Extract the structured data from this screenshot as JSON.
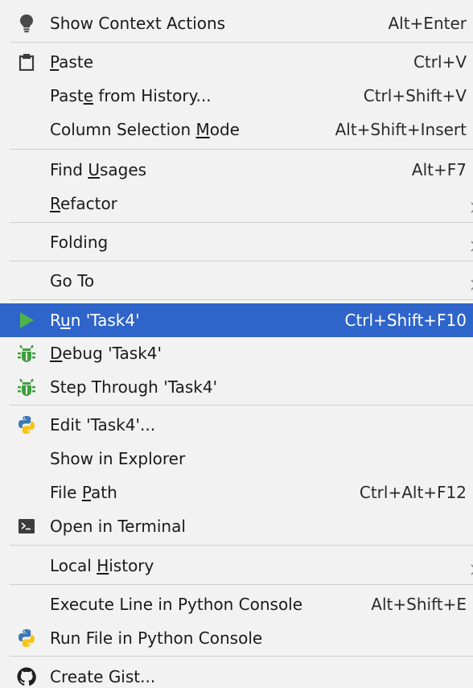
{
  "menu": {
    "items": [
      {
        "label": "Show Context Actions",
        "mnemonic": null,
        "shortcut": "Alt+Enter",
        "icon": "lightbulb-icon"
      },
      {
        "label": "Paste",
        "mnemonic": 0,
        "shortcut": "Ctrl+V",
        "icon": "clipboard-icon"
      },
      {
        "label": "Paste from History...",
        "mnemonic": 4,
        "shortcut": "Ctrl+Shift+V",
        "icon": null
      },
      {
        "label": "Column Selection Mode",
        "mnemonic": 17,
        "shortcut": "Alt+Shift+Insert",
        "icon": null
      },
      {
        "label": "Find Usages",
        "mnemonic": 5,
        "shortcut": "Alt+F7",
        "icon": null
      },
      {
        "label": "Refactor",
        "mnemonic": 0,
        "shortcut": "",
        "icon": null,
        "submenu": true
      },
      {
        "label": "Folding",
        "mnemonic": null,
        "shortcut": "",
        "icon": null,
        "submenu": true
      },
      {
        "label": "Go To",
        "mnemonic": null,
        "shortcut": "",
        "icon": null,
        "submenu": true
      },
      {
        "label": "Run 'Task4'",
        "mnemonic": 1,
        "shortcut": "Ctrl+Shift+F10",
        "icon": "run-icon",
        "selected": true
      },
      {
        "label": "Debug 'Task4'",
        "mnemonic": 0,
        "shortcut": "",
        "icon": "debug-bug-icon"
      },
      {
        "label": "Step Through 'Task4'",
        "mnemonic": null,
        "shortcut": "",
        "icon": "debug-bug-icon"
      },
      {
        "label": "Edit 'Task4'...",
        "mnemonic": null,
        "shortcut": "",
        "icon": "python-logo-icon"
      },
      {
        "label": "Show in Explorer",
        "mnemonic": null,
        "shortcut": "",
        "icon": null
      },
      {
        "label": "File Path",
        "mnemonic": 5,
        "shortcut": "Ctrl+Alt+F12",
        "icon": null
      },
      {
        "label": "Open in Terminal",
        "mnemonic": null,
        "shortcut": "",
        "icon": "terminal-icon"
      },
      {
        "label": "Local History",
        "mnemonic": 6,
        "shortcut": "",
        "icon": null,
        "submenu": true
      },
      {
        "label": "Execute Line in Python Console",
        "mnemonic": null,
        "shortcut": "Alt+Shift+E",
        "icon": null
      },
      {
        "label": "Run File in Python Console",
        "mnemonic": null,
        "shortcut": "",
        "icon": "python-logo-icon"
      },
      {
        "label": "Create Gist...",
        "mnemonic": null,
        "shortcut": "",
        "icon": "github-icon"
      }
    ]
  },
  "colors": {
    "menu_background": "#f2f2f2",
    "selection": "#2f65ca",
    "separator": "#cfcfcf",
    "run_green": "#4db34d",
    "bug_green": "#3f9f3f",
    "python_blue": "#3b78b5",
    "python_yellow": "#f5c518"
  }
}
